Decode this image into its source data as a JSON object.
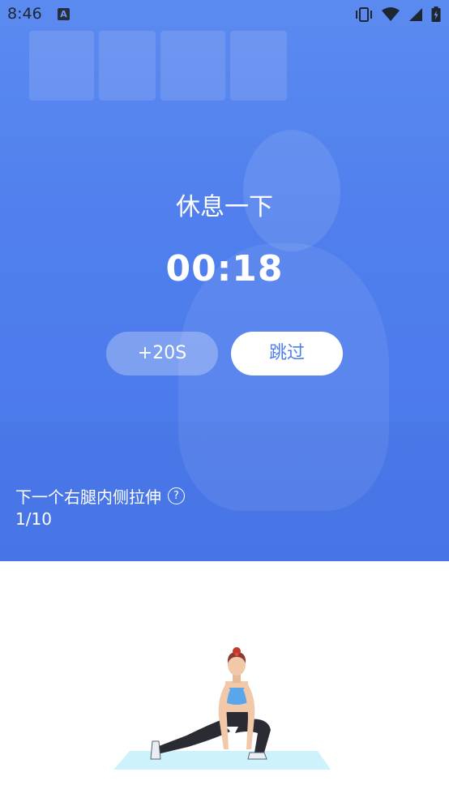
{
  "status_bar": {
    "time": "8:46",
    "notification_icon_letter": "A",
    "icons": [
      "vibrate-icon",
      "wifi-icon",
      "signal-icon",
      "battery-icon"
    ]
  },
  "rest": {
    "title": "休息一下",
    "timer": "00:18",
    "add_time_label": "+20S",
    "skip_label": "跳过"
  },
  "next_exercise": {
    "label": "下一个右腿内侧拉伸",
    "progress": "1/10"
  },
  "colors": {
    "primary_blue": "#4f7eed",
    "mat_color": "#cdf2fc",
    "top_color": "#5fa4ea"
  }
}
